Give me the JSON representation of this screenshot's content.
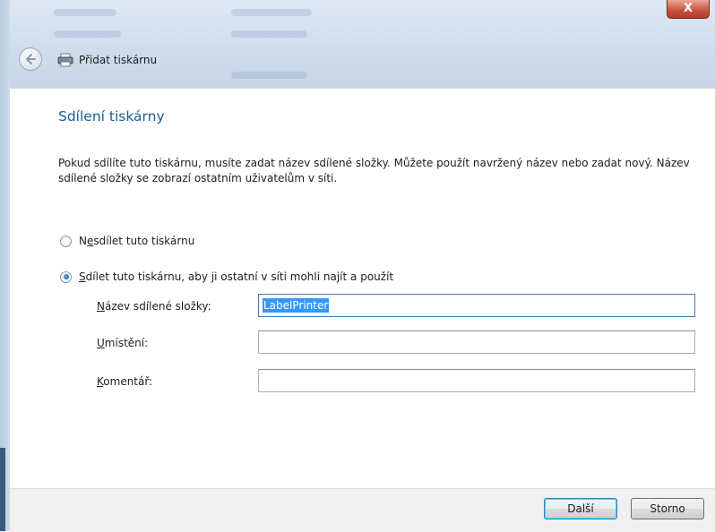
{
  "window": {
    "title": "Přidat tiskárnu",
    "close_glyph": "X"
  },
  "page": {
    "heading": "Sdílení tiskárny",
    "description": "Pokud sdílíte tuto tiskárnu, musíte zadat název sdílené složky. Můžete použít navržený název nebo zadat nový. Název sdílené složky se zobrazí ostatním uživatelům v síti."
  },
  "options": {
    "no_share": {
      "mnemonic_pre": "N",
      "mnemonic": "e",
      "rest": "sdílet tuto tiskárnu",
      "selected": false
    },
    "share": {
      "mnemonic_pre": "",
      "mnemonic": "S",
      "rest": "dílet tuto tiskárnu, aby ji ostatní v síti mohli najít a použít",
      "selected": true
    }
  },
  "fields": {
    "share_name": {
      "mnemonic": "N",
      "rest": "ázev sdílené složky:",
      "value": "LabelPrinter"
    },
    "location": {
      "mnemonic": "U",
      "rest": "místění:",
      "value": ""
    },
    "comment": {
      "mnemonic": "K",
      "rest": "omentář:",
      "value": ""
    }
  },
  "buttons": {
    "next": "Další",
    "cancel": "Storno"
  },
  "icons": {
    "back": "back-arrow-icon",
    "printer": "printer-icon",
    "close": "close-icon"
  }
}
